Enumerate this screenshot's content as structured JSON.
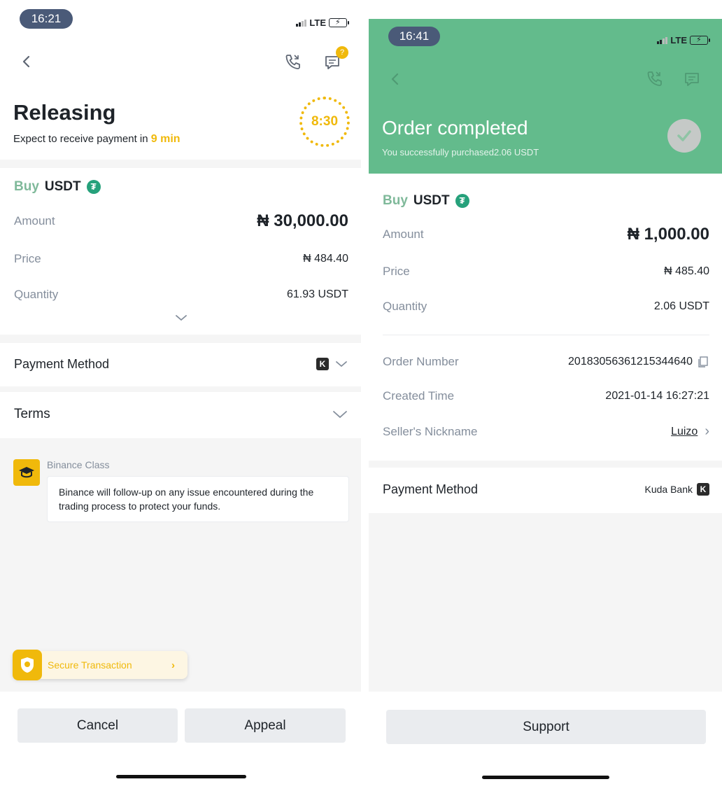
{
  "left": {
    "status_time": "16:21",
    "network": "LTE",
    "chat_badge": "?",
    "title": "Releasing",
    "subtitle_prefix": "Expect to receive payment in",
    "subtitle_time": "9 min",
    "timer": "8:30",
    "side": "Buy",
    "asset": "USDT",
    "amount_label": "Amount",
    "amount_value": "₦ 30,000.00",
    "price_label": "Price",
    "price_value": "₦ 484.40",
    "quantity_label": "Quantity",
    "quantity_value": "61.93 USDT",
    "payment_method_label": "Payment Method",
    "terms_label": "Terms",
    "class_sender": "Binance Class",
    "class_message": "Binance will follow-up on any issue encountered during the trading process to protect your funds.",
    "secure_label": "Secure Transaction",
    "cancel_label": "Cancel",
    "appeal_label": "Appeal"
  },
  "right": {
    "status_time": "16:41",
    "network": "LTE",
    "title": "Order completed",
    "subtitle": "You successfully purchased2.06 USDT",
    "side": "Buy",
    "asset": "USDT",
    "amount_label": "Amount",
    "amount_value": "₦ 1,000.00",
    "price_label": "Price",
    "price_value": "₦ 485.40",
    "quantity_label": "Quantity",
    "quantity_value": "2.06 USDT",
    "order_number_label": "Order Number",
    "order_number_value": "20183056361215344640",
    "created_time_label": "Created Time",
    "created_time_value": "2021-01-14 16:27:21",
    "seller_label": "Seller's Nickname",
    "seller_value": "Luizo",
    "payment_method_label": "Payment Method",
    "payment_method_value": "Kuda Bank",
    "support_label": "Support"
  },
  "colors": {
    "accent_yellow": "#f0b90b",
    "buy_green": "#7fb99a",
    "header_green": "#63bb8c",
    "tether_green": "#26a17b",
    "time_pill": "#4a5a78"
  },
  "icons": {
    "back": "back-arrow-icon",
    "call": "phone-call-icon",
    "chat": "chat-bubble-icon",
    "check": "check-circle-icon",
    "copy": "copy-icon",
    "chevron": "chevron-down-icon",
    "kuda": "kuda-bank-logo",
    "class": "graduation-cap-icon",
    "shield": "shield-icon"
  }
}
